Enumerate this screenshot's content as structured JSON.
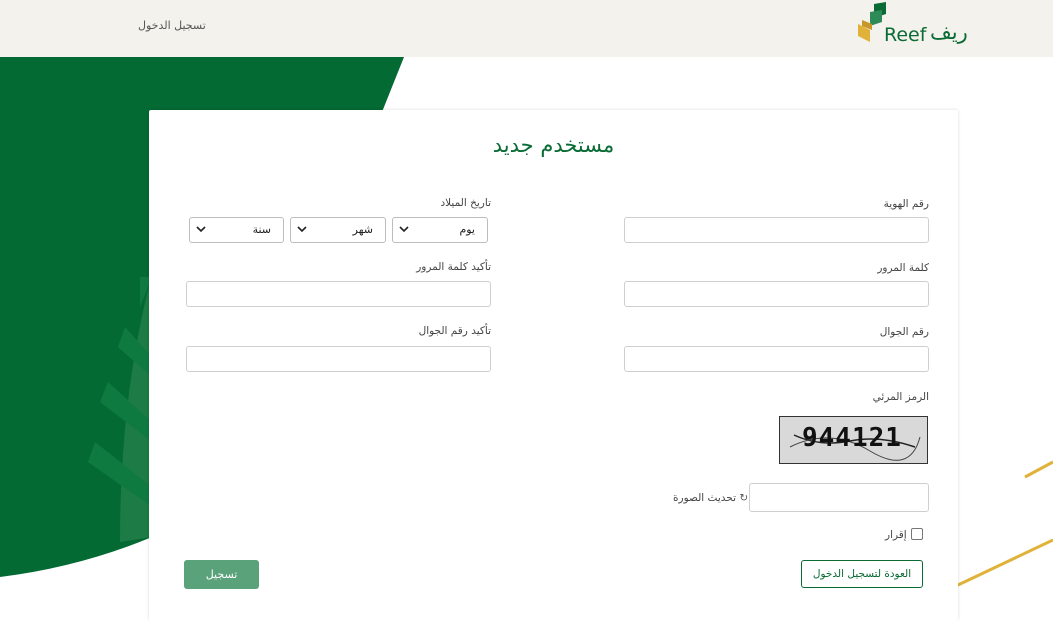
{
  "header": {
    "login_link": "تسجيل الدخول",
    "logo_en": "Reef",
    "logo_ar": "ريف"
  },
  "form": {
    "title": "مستخدم جديد",
    "id_label": "رقم الهوية",
    "dob_label": "تاريخ الميلاد",
    "dob_day": "يوم",
    "dob_month": "شهر",
    "dob_year": "سنة",
    "password_label": "كلمة المرور",
    "confirm_password_label": "تأكيد كلمة المرور",
    "mobile_label": "رقم الجوال",
    "confirm_mobile_label": "تأكيد رقم الجوال",
    "captcha_label": "الرمز المرئي",
    "captcha_value": "944121",
    "refresh_label": "تحديث الصورة",
    "consent_label": "إقرار",
    "back_button": "العودة لتسجيل الدخول",
    "register_button": "تسجيل"
  },
  "colors": {
    "brand_green": "#0a6b35",
    "light_green": "#5aa27a",
    "gold": "#e0b23a",
    "header_bg": "#f3f2ec"
  }
}
